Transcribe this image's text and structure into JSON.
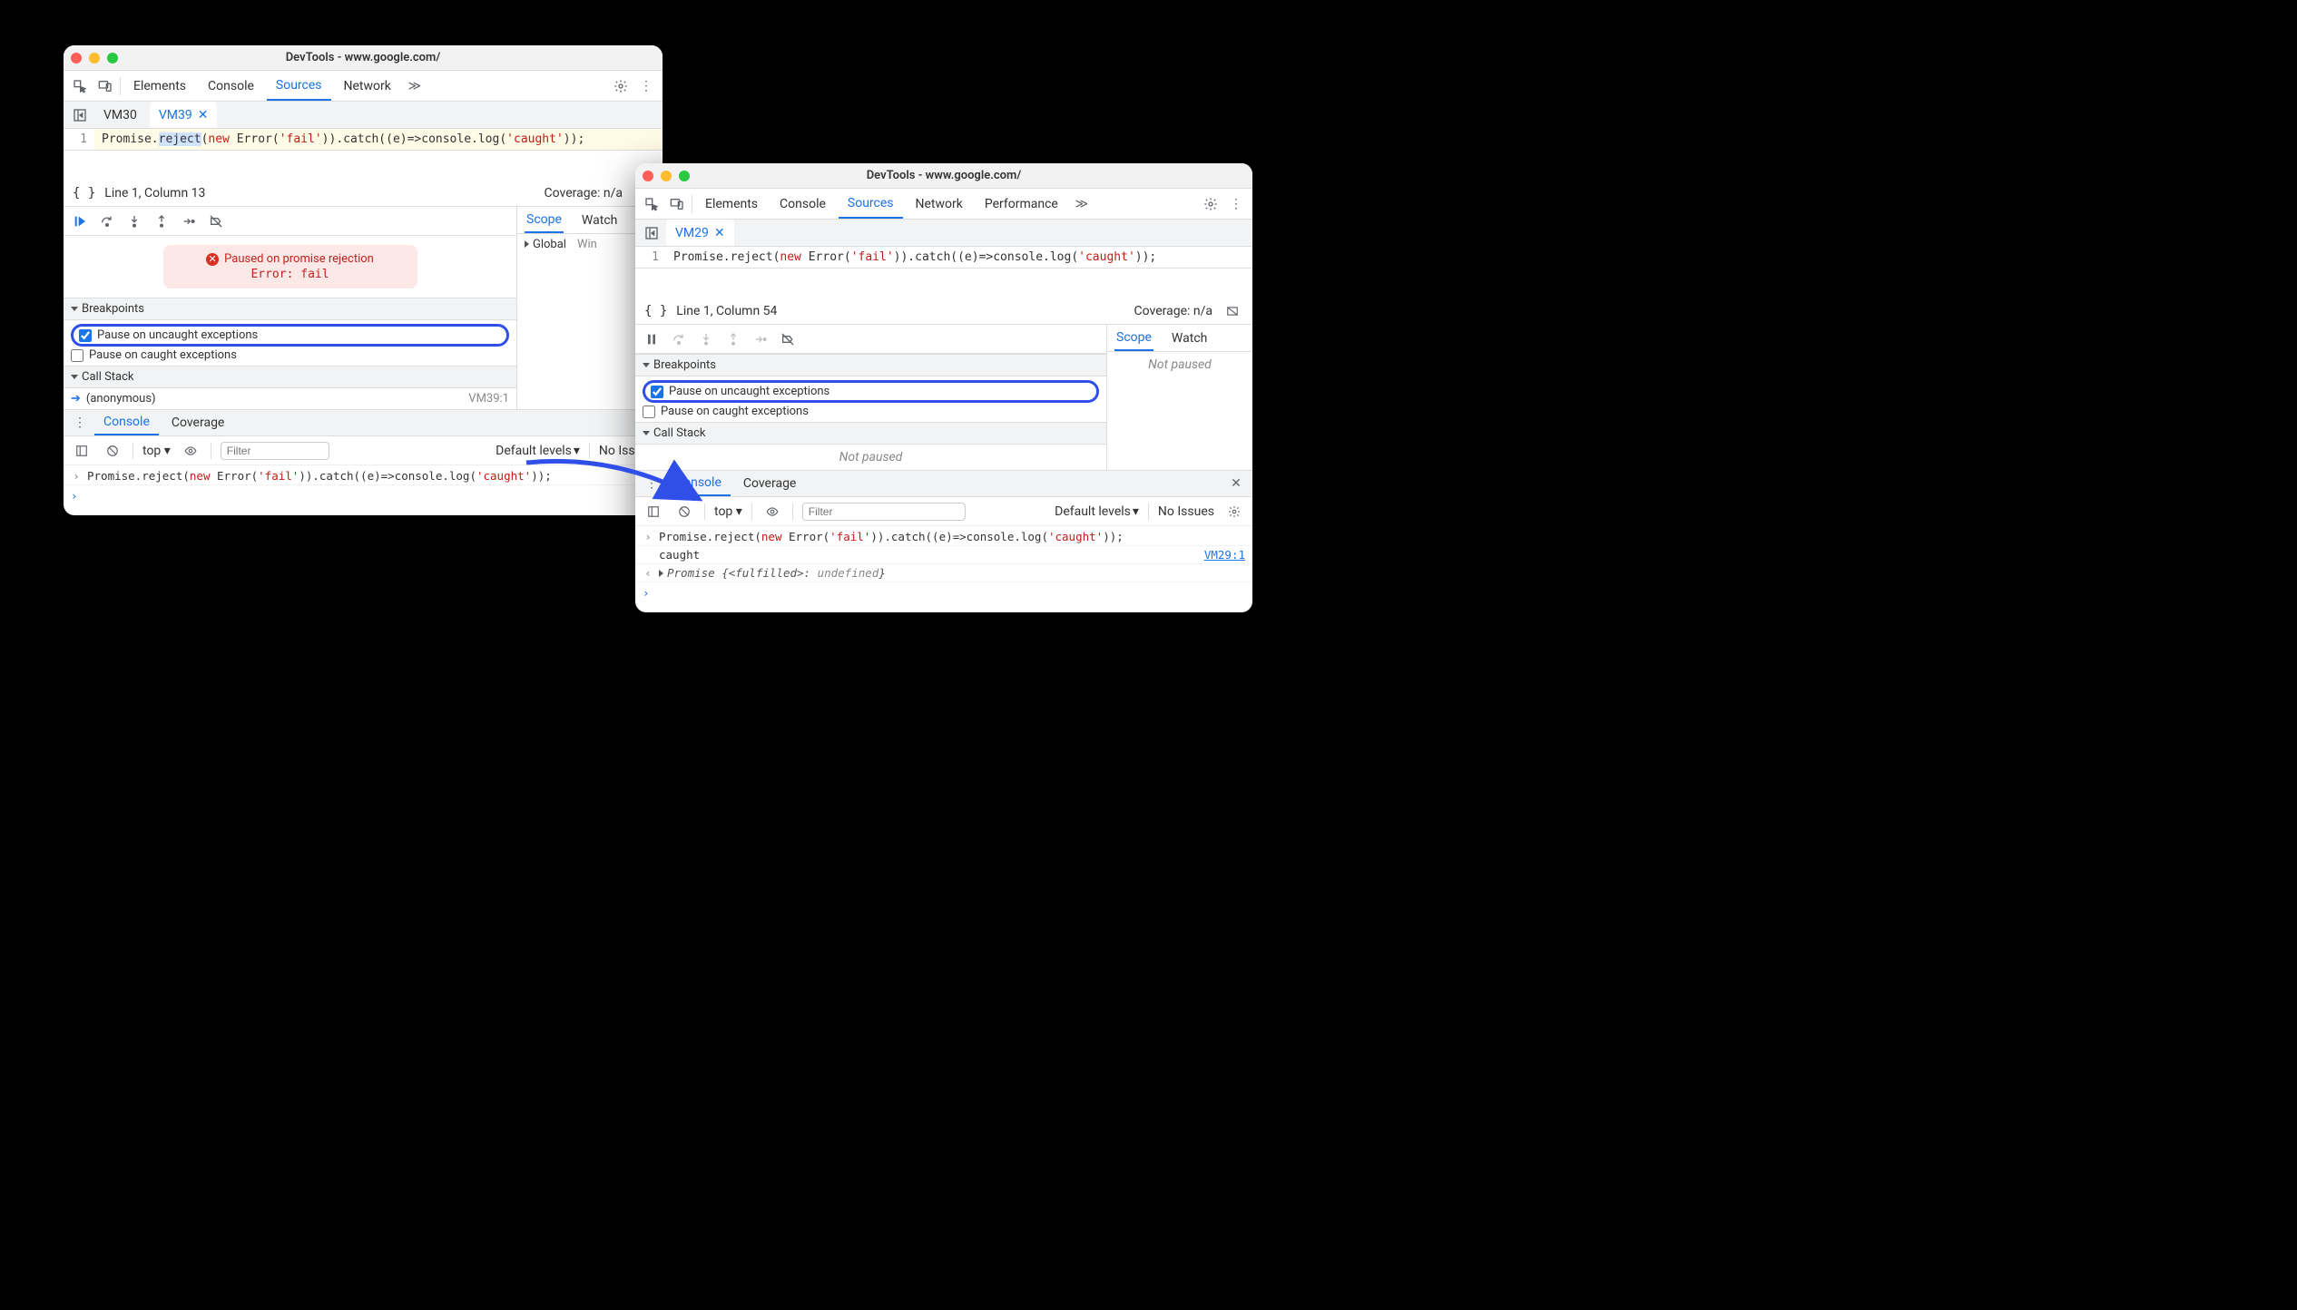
{
  "left": {
    "title": "DevTools - www.google.com/",
    "tabs": [
      "Elements",
      "Console",
      "Sources",
      "Network"
    ],
    "active_tab": "Sources",
    "vm_tabs": [
      "VM30",
      "VM39"
    ],
    "active_vm": "VM39",
    "code": {
      "line_num": "1",
      "pre": "Promise.",
      "sel": "reject",
      "post1": "(",
      "new": "new",
      "post2": " Error(",
      "str1": "'fail'",
      "post3": ")).catch((e)=>console.log(",
      "str2": "'caught'",
      "post4": "));"
    },
    "cursor": "Line 1, Column 13",
    "coverage": "Coverage: n/a",
    "pause": {
      "title": "Paused on promise rejection",
      "err": "Error: fail"
    },
    "bp_section": "Breakpoints",
    "bp_uncaught": "Pause on uncaught exceptions",
    "bp_caught": "Pause on caught exceptions",
    "cs_section": "Call Stack",
    "cs_item": "(anonymous)",
    "cs_src": "VM39:1",
    "scope_tab": "Scope",
    "watch_tab": "Watch",
    "scope_global": "Global",
    "scope_window": "Win",
    "drawer_tabs": {
      "console": "Console",
      "coverage": "Coverage"
    },
    "ctx": "top",
    "filter_ph": "Filter",
    "levels": "Default levels",
    "no_issues": "No Issues",
    "console_cmd": {
      "pre": "Promise.reject(",
      "new": "new",
      "mid": " Error(",
      "str1": "'fail'",
      "mid2": ")).catch((e)=>console.log(",
      "str2": "'caught'",
      "end": "));"
    }
  },
  "right": {
    "title": "DevTools - www.google.com/",
    "tabs": [
      "Elements",
      "Console",
      "Sources",
      "Network",
      "Performance"
    ],
    "active_tab": "Sources",
    "vm_tabs": [
      "VM29"
    ],
    "active_vm": "VM29",
    "code": {
      "line_num": "1",
      "pre": "Promise.reject(",
      "new": "new",
      "post2": " Error(",
      "str1": "'fail'",
      "post3": ")).catch((e)=>console.log(",
      "str2": "'caught'",
      "post4": "));"
    },
    "cursor": "Line 1, Column 54",
    "coverage": "Coverage: n/a",
    "bp_section": "Breakpoints",
    "bp_uncaught": "Pause on uncaught exceptions",
    "bp_caught": "Pause on caught exceptions",
    "cs_section": "Call Stack",
    "not_paused": "Not paused",
    "scope_tab": "Scope",
    "watch_tab": "Watch",
    "scope_not_paused": "Not paused",
    "drawer_tabs": {
      "console": "Console",
      "coverage": "Coverage"
    },
    "ctx": "top",
    "filter_ph": "Filter",
    "levels": "Default levels",
    "no_issues": "No Issues",
    "console_cmd": {
      "pre": "Promise.reject(",
      "new": "new",
      "mid": " Error(",
      "str1": "'fail'",
      "mid2": ")).catch((e)=>console.log(",
      "str2": "'caught'",
      "end": "));"
    },
    "out_caught": "caught",
    "out_link": "VM29:1",
    "out_promise_pre": "Promise {",
    "out_promise_state": "<fulfilled>:",
    "out_promise_val": " undefined",
    "out_promise_post": "}"
  }
}
